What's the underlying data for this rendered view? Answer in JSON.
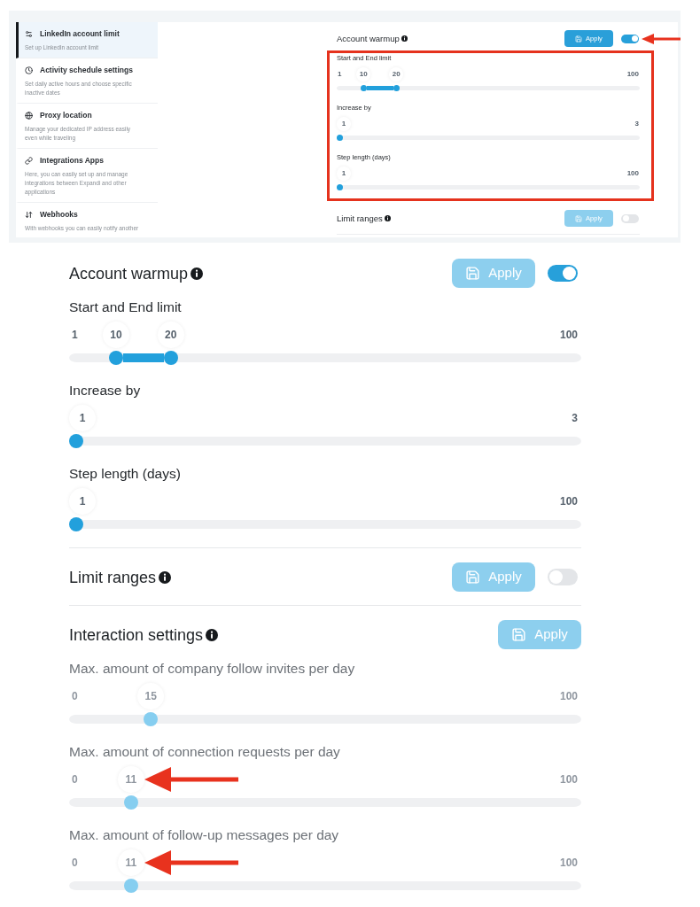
{
  "top_screenshot": {
    "sidebar": {
      "items": [
        {
          "title": "LinkedIn account limit",
          "description": "Set up LinkedIn account limit",
          "selected": true
        },
        {
          "title": "Activity schedule settings",
          "description": "Set daily active hours and choose specific inactive dates",
          "selected": false
        },
        {
          "title": "Proxy location",
          "description": "Manage your dedicated IP address easily even while traveling",
          "selected": false
        },
        {
          "title": "Integrations Apps",
          "description": "Here, you can easily set up and manage integrations between Expandi and other applications",
          "selected": false
        },
        {
          "title": "Webhooks",
          "description": "With webhooks you can easily notify another",
          "selected": false
        }
      ]
    },
    "sections": [
      {
        "title": "Account warmup",
        "apply": {
          "label": "Apply",
          "disabled": false
        },
        "toggle": {
          "on": true,
          "callout": true
        },
        "slider_group": {
          "outlined": true,
          "sliders": [
            {
              "label": "Start and End limit",
              "min": "1",
              "max": "100",
              "disabled": false,
              "callout": false,
              "thumbs": [
                {
                  "value": "10",
                  "level": 0.08
                },
                {
                  "value": "20",
                  "level": 0.19
                }
              ]
            },
            {
              "label": "Increase by",
              "max": "3",
              "disabled": false,
              "callout": false,
              "thumbs": [
                {
                  "value": "1",
                  "level": 0
                }
              ]
            },
            {
              "label": "Step length (days)",
              "max": "100",
              "disabled": false,
              "callout": false,
              "thumbs": [
                {
                  "value": "1",
                  "level": 0
                }
              ]
            }
          ]
        }
      },
      {
        "title": "Limit ranges",
        "apply": {
          "label": "Apply",
          "disabled": true
        },
        "toggle": {
          "on": false,
          "callout": false
        }
      }
    ]
  },
  "zoomed_view": {
    "sections": [
      {
        "title": "Account warmup",
        "apply": {
          "label": "Apply",
          "disabled": true
        },
        "toggle": {
          "on": true,
          "callout": false
        },
        "slider_group": {
          "outlined": false,
          "sliders": [
            {
              "label": "Start and End limit",
              "min": "1",
              "max": "100",
              "disabled": false,
              "callout": false,
              "thumbs": [
                {
                  "value": "10",
                  "level": 0.08
                },
                {
                  "value": "20",
                  "level": 0.19
                }
              ]
            },
            {
              "label": "Increase by",
              "max": "3",
              "disabled": false,
              "callout": false,
              "thumbs": [
                {
                  "value": "1",
                  "level": 0
                }
              ]
            },
            {
              "label": "Step length (days)",
              "max": "100",
              "disabled": false,
              "callout": false,
              "thumbs": [
                {
                  "value": "1",
                  "level": 0
                }
              ]
            }
          ]
        }
      },
      {
        "title": "Limit ranges",
        "apply": {
          "label": "Apply",
          "disabled": true
        },
        "toggle": {
          "on": false,
          "callout": false
        }
      },
      {
        "title": "Interaction settings",
        "apply": {
          "label": "Apply",
          "disabled": true
        },
        "slider_group": {
          "outlined": false,
          "sliders": [
            {
              "label": "Max. amount of company follow invites per day",
              "min": "0",
              "max": "100",
              "disabled": true,
              "callout": false,
              "thumbs": [
                {
                  "value": "15",
                  "level": 0.15
                }
              ]
            },
            {
              "label": "Max. amount of connection requests per day",
              "min": "0",
              "max": "100",
              "disabled": true,
              "callout": true,
              "thumbs": [
                {
                  "value": "11",
                  "level": 0.11
                }
              ]
            },
            {
              "label": "Max. amount of follow-up messages per day",
              "min": "0",
              "max": "100",
              "disabled": true,
              "callout": true,
              "thumbs": [
                {
                  "value": "11",
                  "level": 0.11
                }
              ]
            }
          ]
        }
      }
    ]
  }
}
